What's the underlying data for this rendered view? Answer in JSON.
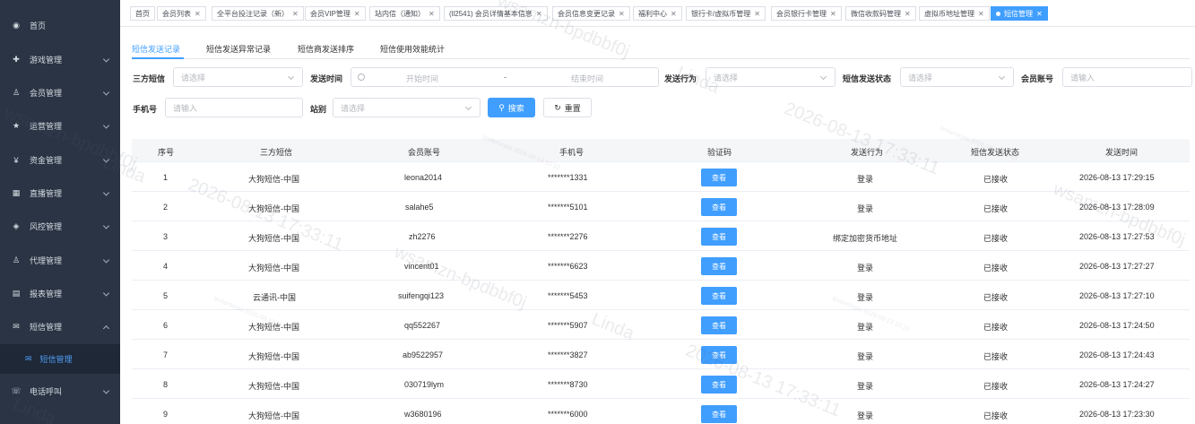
{
  "sidebar": {
    "items": [
      {
        "label": "首页",
        "icon": "dashboard-icon"
      },
      {
        "label": "游戏管理",
        "icon": "game-icon"
      },
      {
        "label": "会员管理",
        "icon": "members-icon"
      },
      {
        "label": "运营管理",
        "icon": "star-icon"
      },
      {
        "label": "资金管理",
        "icon": "yen-icon"
      },
      {
        "label": "直播管理",
        "icon": "live-icon"
      },
      {
        "label": "风控管理",
        "icon": "risk-icon"
      },
      {
        "label": "代理管理",
        "icon": "agent-icon"
      },
      {
        "label": "报表管理",
        "icon": "report-icon"
      },
      {
        "label": "短信管理",
        "icon": "sms-icon"
      },
      {
        "label": "电话呼叫",
        "icon": "phone-icon"
      }
    ],
    "active_sub": {
      "label": "短信管理",
      "icon": "mail-icon"
    }
  },
  "tabs": [
    "首页",
    "会员列表",
    "全平台投注记录（新）",
    "会员VIP管理",
    "站内信（通知）",
    "(ll2541) 会员详情基本信息",
    "会员信息变更记录",
    "福利中心",
    "银行卡/虚拟币管理",
    "会员银行卡管理",
    "微信收款码管理",
    "虚拟币地址管理",
    "短信管理"
  ],
  "subtabs": [
    "短信发送记录",
    "短信发送异常记录",
    "短信商发送排序",
    "短信使用效能统计"
  ],
  "filters": {
    "provider_label": "三方短信",
    "provider_placeholder": "请选择",
    "time_label": "发送时间",
    "start_placeholder": "开始时间",
    "range_sep": "-",
    "end_placeholder": "结束时间",
    "action_label": "发送行为",
    "action_placeholder": "请选择",
    "status_label": "短信发送状态",
    "status_placeholder": "请选择",
    "account_label": "会员账号",
    "account_placeholder": "请输入",
    "phone_label": "手机号",
    "phone_placeholder": "请输入",
    "site_label": "站别",
    "site_placeholder": "请选择",
    "search_label": "搜索",
    "reset_label": "重置"
  },
  "table": {
    "columns": [
      "序号",
      "三方短信",
      "会员账号",
      "手机号",
      "验证码",
      "发送行为",
      "短信发送状态",
      "发送时间"
    ],
    "view_label": "查看",
    "rows": [
      [
        "1",
        "大狗短信-中国",
        "leona2014",
        "*******1331",
        "登录",
        "已接收",
        "2026-08-13 17:29:15"
      ],
      [
        "2",
        "大狗短信-中国",
        "salahe5",
        "*******5101",
        "登录",
        "已接收",
        "2026-08-13 17:28:09"
      ],
      [
        "3",
        "大狗短信-中国",
        "zh2276",
        "*******2276",
        "绑定加密货币地址",
        "已接收",
        "2026-08-13 17:27:53"
      ],
      [
        "4",
        "大狗短信-中国",
        "vincent01",
        "*******6623",
        "登录",
        "已接收",
        "2026-08-13 17:27:27"
      ],
      [
        "5",
        "云通讯-中国",
        "suifengqi123",
        "*******5453",
        "登录",
        "已接收",
        "2026-08-13 17:27:10"
      ],
      [
        "6",
        "大狗短信-中国",
        "qq552267",
        "*******5907",
        "登录",
        "已接收",
        "2026-08-13 17:24:50"
      ],
      [
        "7",
        "大狗短信-中国",
        "ab9522957",
        "*******3827",
        "登录",
        "已接收",
        "2026-08-13 17:24:43"
      ],
      [
        "8",
        "大狗短信-中国",
        "030719lym",
        "*******8730",
        "登录",
        "已接收",
        "2026-08-13 17:24:27"
      ],
      [
        "9",
        "大狗短信-中国",
        "w3680196",
        "*******6000",
        "登录",
        "已接收",
        "2026-08-13 17:23:30"
      ]
    ]
  },
  "watermark": {
    "name": "wsamzn-bpdbbf0j",
    "user": "Linda",
    "time": "2026-08-13 17:33:11",
    "small": "lindaminjas 2026-08-13 10:10"
  },
  "colors": {
    "accent": "#409eff",
    "sidebar": "#2a3444",
    "sidebar_active": "#1f2837"
  }
}
